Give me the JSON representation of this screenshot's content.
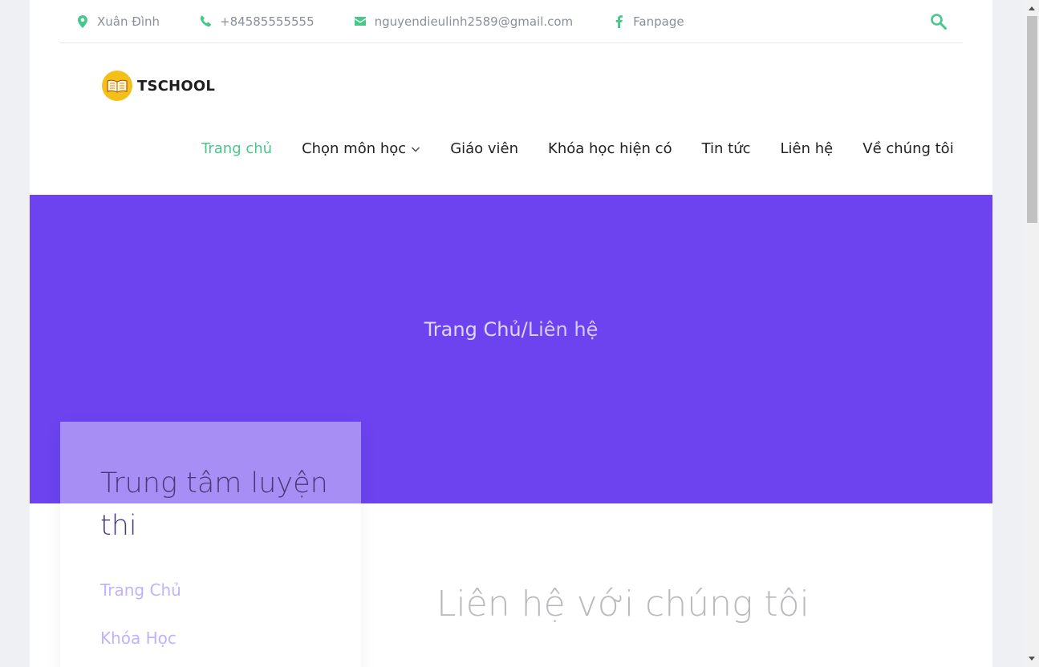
{
  "topbar": {
    "address": "Xuân Đình",
    "phone": "+84585555555",
    "email": "nguyendieulinh2589@gmail.com",
    "fanpage": "Fanpage",
    "accent_color": "#46c88b"
  },
  "logo": {
    "text": "TSCHOOL"
  },
  "nav": {
    "items": [
      {
        "label": "Trang chủ"
      },
      {
        "label": "Chọn môn học"
      },
      {
        "label": "Giáo viên"
      },
      {
        "label": "Khóa học hiện có"
      },
      {
        "label": "Tin tức"
      },
      {
        "label": "Liên hệ"
      },
      {
        "label": "Về chúng tôi"
      }
    ]
  },
  "hero": {
    "color": "#6c43ef",
    "breadcrumb_home": "Trang Chủ",
    "breadcrumb_sep": "/",
    "breadcrumb_current": "Liên hệ"
  },
  "sidebar": {
    "title": "Trung tâm luyện thi",
    "links": [
      {
        "label": "Trang Chủ"
      },
      {
        "label": "Khóa Học"
      }
    ]
  },
  "main": {
    "title": "Liên hệ với chúng tôi"
  }
}
